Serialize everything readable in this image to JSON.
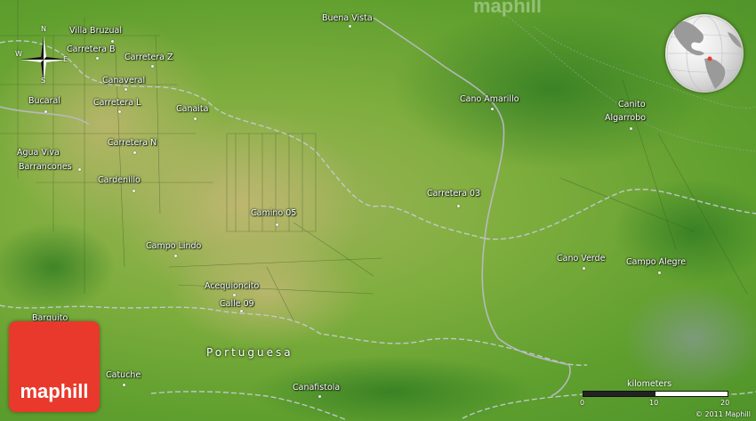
{
  "brand": "maphill",
  "copyright": "© 2011 Maphill",
  "region_label": "Portuguesa",
  "compass": {
    "n": "N",
    "s": "S",
    "e": "E",
    "w": "W"
  },
  "scale": {
    "title": "kilometers",
    "ticks": [
      "0",
      "10",
      "20"
    ]
  },
  "places": [
    {
      "name": "Villa Bruzual"
    },
    {
      "name": "Buena Vista"
    },
    {
      "name": "Carretera B"
    },
    {
      "name": "Carretera Z"
    },
    {
      "name": "Canaveral"
    },
    {
      "name": "Bucaral"
    },
    {
      "name": "Carretera L"
    },
    {
      "name": "Canaita"
    },
    {
      "name": "Cano Amarillo"
    },
    {
      "name": "Canito"
    },
    {
      "name": "Algarrobo"
    },
    {
      "name": "Carretera N"
    },
    {
      "name": "Agua Viva"
    },
    {
      "name": "Barrancones"
    },
    {
      "name": "Cardenillo"
    },
    {
      "name": "Carretera 03"
    },
    {
      "name": "Camino 05"
    },
    {
      "name": "Campo Lindo"
    },
    {
      "name": "Cano Verde"
    },
    {
      "name": "Campo Alegre"
    },
    {
      "name": "Acequioncito"
    },
    {
      "name": "Calle 09"
    },
    {
      "name": "Barquito"
    },
    {
      "name": "Catuche"
    },
    {
      "name": "Canafistola"
    }
  ]
}
